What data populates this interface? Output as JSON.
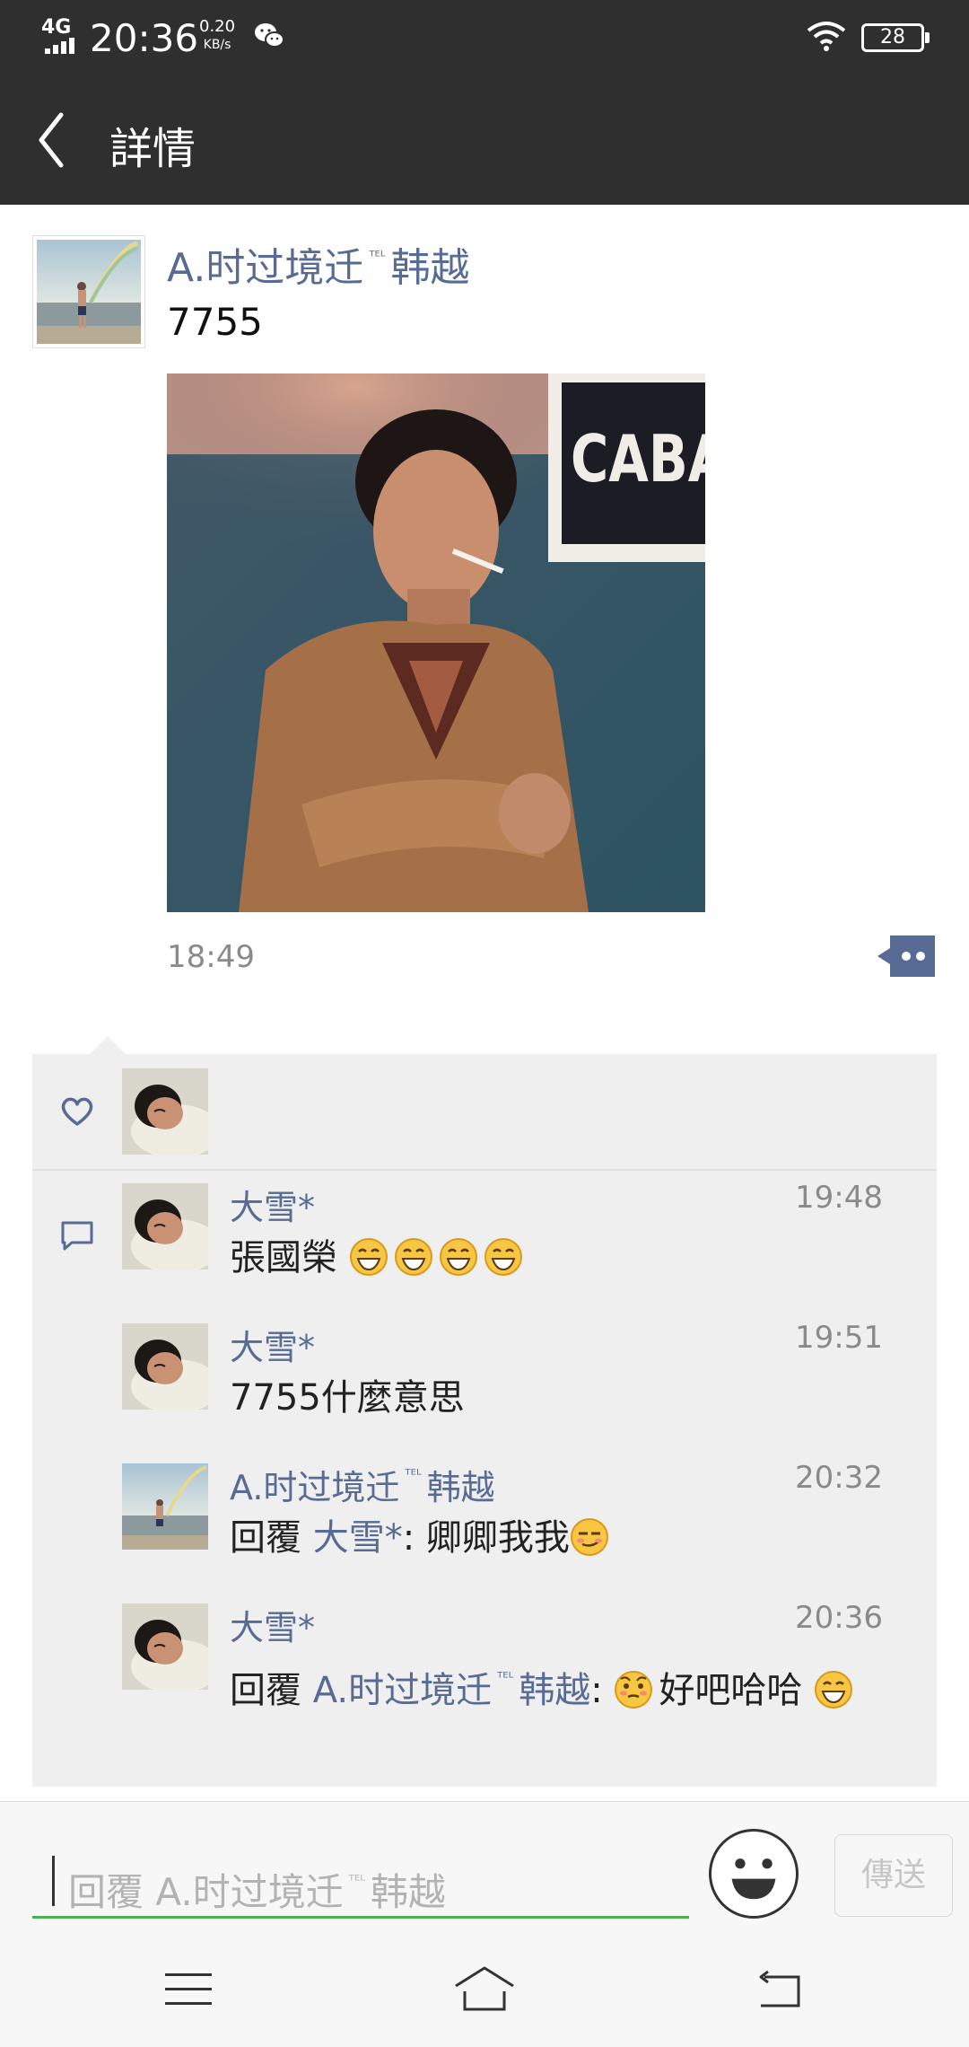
{
  "status_bar": {
    "network": "4G",
    "time": "20:36",
    "speed_value": "0.20",
    "speed_unit": "KB/s",
    "battery": "28"
  },
  "header": {
    "title": "詳情"
  },
  "post": {
    "author_part1": "A.时过境迁",
    "author_tel": "ᵀᴱᴸ",
    "author_part2": "韩越",
    "text": "7755",
    "time": "18:49",
    "image_sign_text": "CABAI"
  },
  "comments": [
    {
      "name": "大雪*",
      "time": "19:48",
      "text": "張國榮"
    },
    {
      "name": "大雪*",
      "time": "19:51",
      "text": "7755什麼意思"
    },
    {
      "name_part1": "A.时过境迁",
      "name_tel": "ᵀᴱᴸ",
      "name_part2": "韩越",
      "time": "20:32",
      "reply_prefix": "回覆",
      "reply_to": "大雪*",
      "reply_text": ": 卿卿我我"
    },
    {
      "name": "大雪*",
      "time": "20:36",
      "reply_prefix": "回覆",
      "reply_to_part1": "A.时过境迁",
      "reply_to_tel": "ᵀᴱᴸ",
      "reply_to_part2": "韩越",
      "reply_colon": ":",
      "reply_text": "好吧哈哈"
    }
  ],
  "reply_bar": {
    "placeholder_prefix": "回覆",
    "placeholder_name1": "A.时过境迁",
    "placeholder_tel": "ᵀᴱᴸ",
    "placeholder_name2": "韩越",
    "send_label": "傳送"
  },
  "colors": {
    "link": "#576b95",
    "header_bg": "#2f2f2f",
    "panel_bg": "#efefef",
    "input_underline": "#4caf50"
  },
  "icons": [
    "back-arrow-icon",
    "heart-icon",
    "comment-icon",
    "emoji-icon",
    "menu-icon",
    "home-icon",
    "back-icon",
    "wifi-icon",
    "wechat-icon"
  ]
}
